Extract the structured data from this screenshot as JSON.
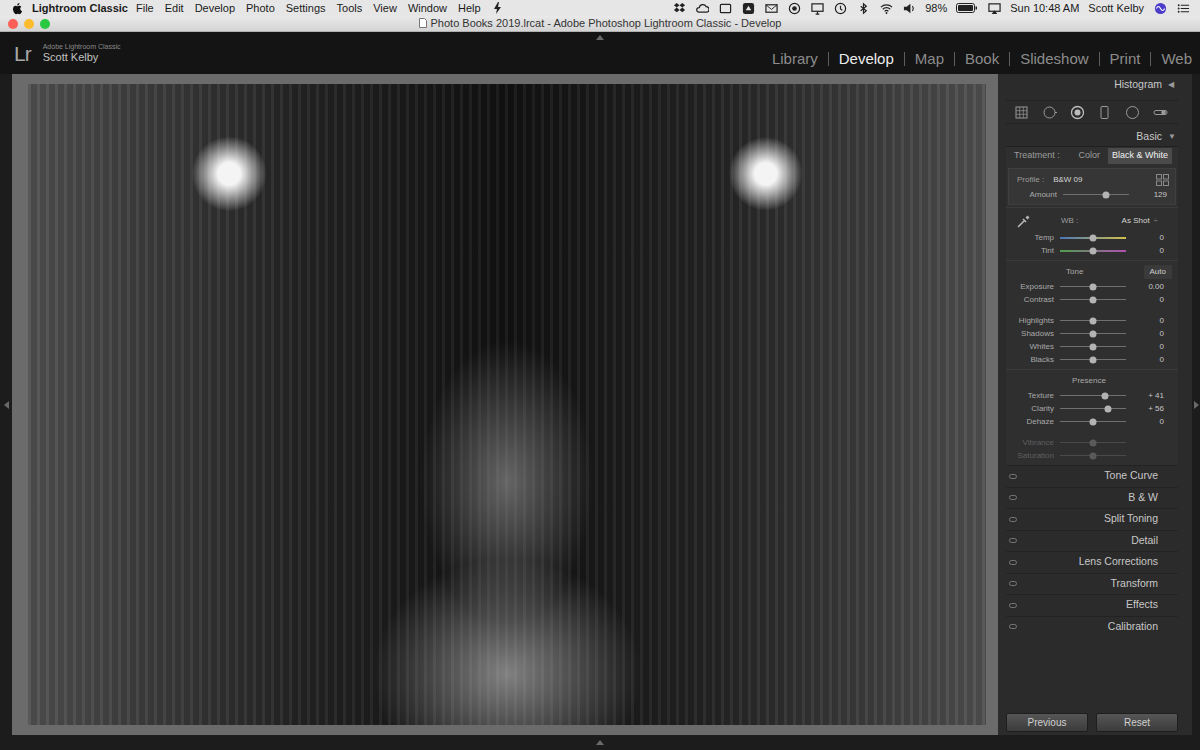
{
  "menubar": {
    "app": "Lightroom Classic",
    "menus": [
      "File",
      "Edit",
      "Develop",
      "Photo",
      "Settings",
      "Tools",
      "View",
      "Window",
      "Help"
    ],
    "battery": "98%",
    "clock": "Sun 10:48 AM",
    "user": "Scott Kelby"
  },
  "window": {
    "title": "Photo Books 2019.lrcat - Adobe Photoshop Lightroom Classic - Develop"
  },
  "identity": {
    "logo": "Lr",
    "product": "Adobe Lightroom Classic",
    "user": "Scott Kelby"
  },
  "modules": [
    {
      "label": "Library",
      "selected": false
    },
    {
      "label": "Develop",
      "selected": true
    },
    {
      "label": "Map",
      "selected": false
    },
    {
      "label": "Book",
      "selected": false
    },
    {
      "label": "Slideshow",
      "selected": false
    },
    {
      "label": "Print",
      "selected": false
    },
    {
      "label": "Web",
      "selected": false
    }
  ],
  "histogram": {
    "title": "Histogram",
    "toggle": "◀"
  },
  "basic": {
    "title": "Basic",
    "toggle": "▼",
    "treatment": {
      "label": "Treatment :",
      "options": [
        {
          "label": "Color",
          "selected": false
        },
        {
          "label": "Black & White",
          "selected": true
        }
      ]
    },
    "profile": {
      "label": "Profile :",
      "value": "B&W 09"
    },
    "amount": {
      "label": "Amount",
      "kind": "plain",
      "level": 0.65,
      "reading": "129",
      "disabled": false
    },
    "wb": {
      "label": "WB :",
      "value": "As Shot",
      "arrows": "÷"
    },
    "wb_sliders": [
      {
        "label": "Temp",
        "kind": "temp",
        "level": 0.5,
        "reading": "0",
        "disabled": false
      },
      {
        "label": "Tint",
        "kind": "tint",
        "level": 0.5,
        "reading": "0",
        "disabled": false
      }
    ],
    "tone": {
      "title": "Tone",
      "auto": "Auto",
      "sliders": [
        [
          {
            "label": "Exposure",
            "kind": "plain",
            "level": 0.5,
            "reading": "0.00",
            "disabled": false
          },
          {
            "label": "Contrast",
            "kind": "plain",
            "level": 0.5,
            "reading": "0",
            "disabled": false
          }
        ],
        [
          {
            "label": "Highlights",
            "kind": "plain",
            "level": 0.5,
            "reading": "0",
            "disabled": false
          },
          {
            "label": "Shadows",
            "kind": "plain",
            "level": 0.5,
            "reading": "0",
            "disabled": false
          },
          {
            "label": "Whites",
            "kind": "plain",
            "level": 0.5,
            "reading": "0",
            "disabled": false
          },
          {
            "label": "Blacks",
            "kind": "plain",
            "level": 0.5,
            "reading": "0",
            "disabled": false
          }
        ]
      ]
    },
    "presence": {
      "title": "Presence",
      "sliders": [
        [
          {
            "label": "Texture",
            "kind": "plain",
            "level": 0.68,
            "reading": "+ 41",
            "disabled": false
          },
          {
            "label": "Clarity",
            "kind": "plain",
            "level": 0.73,
            "reading": "+ 56",
            "disabled": false
          },
          {
            "label": "Dehaze",
            "kind": "plain",
            "level": 0.5,
            "reading": "0",
            "disabled": false
          }
        ],
        [
          {
            "label": "Vibrance",
            "kind": "plain",
            "level": 0.5,
            "disabled": true
          },
          {
            "label": "Saturation",
            "kind": "plain",
            "level": 0.5,
            "disabled": true
          }
        ]
      ]
    }
  },
  "panels": [
    "Tone Curve",
    "B & W",
    "Split Toning",
    "Detail",
    "Lens Corrections",
    "Transform",
    "Effects",
    "Calibration"
  ],
  "buttons": [
    "Previous",
    "Reset"
  ]
}
